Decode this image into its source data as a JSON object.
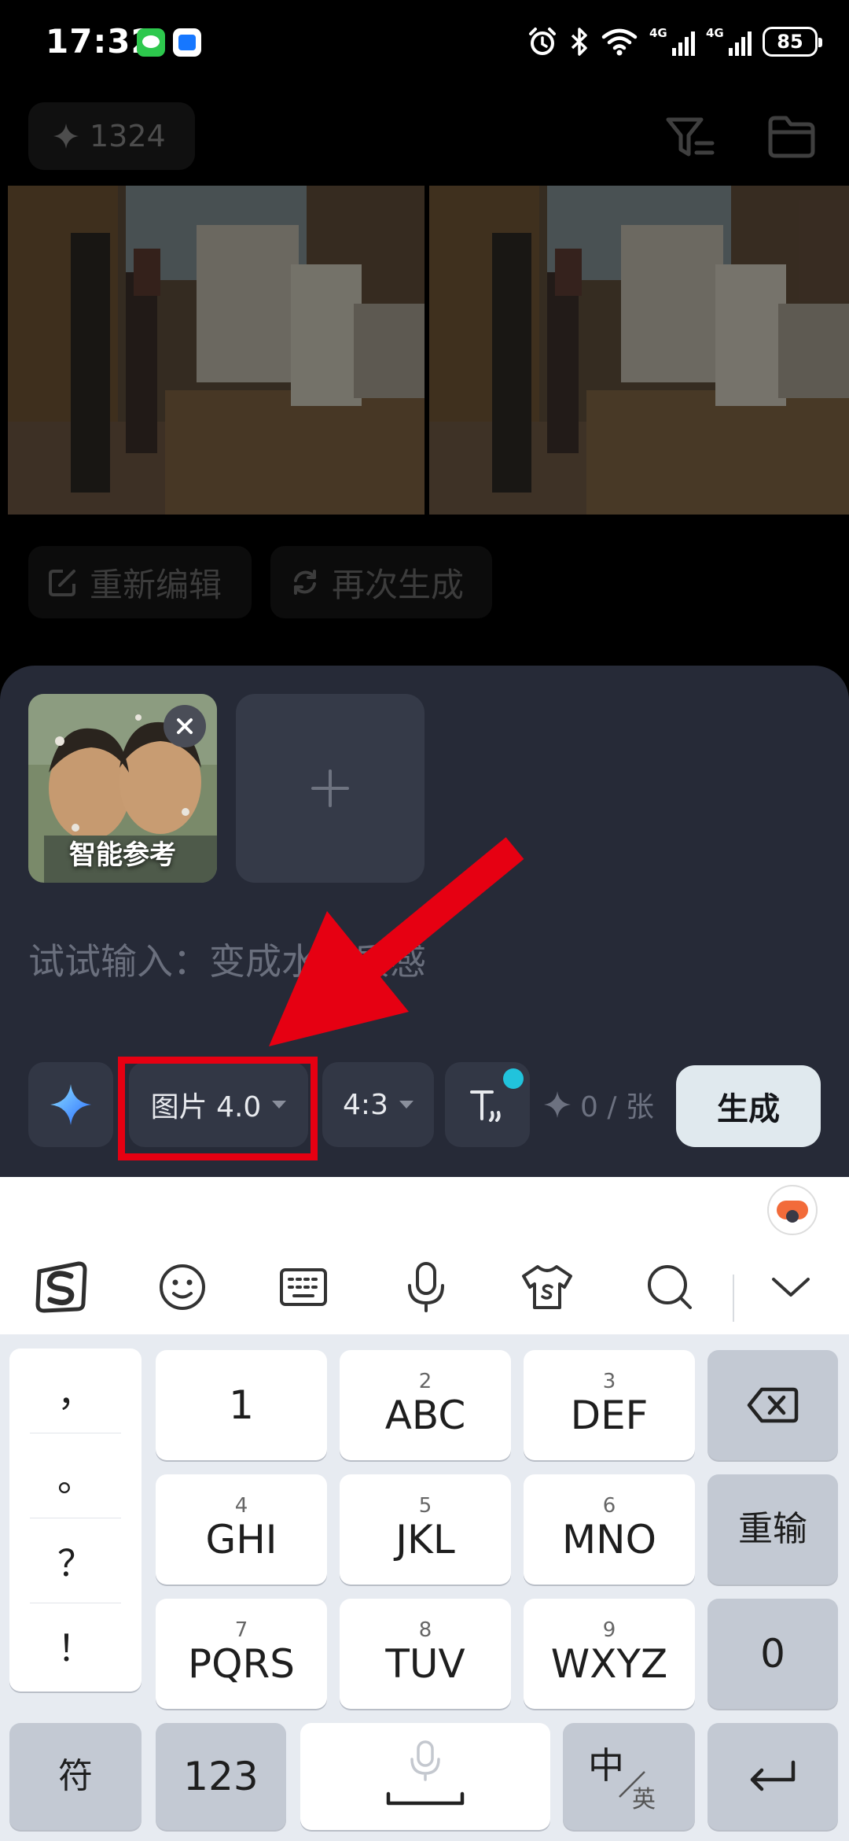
{
  "status_bar": {
    "time": "17:32",
    "network_left": "4G",
    "network_right": "4G",
    "battery": "85"
  },
  "header": {
    "credits": "1324"
  },
  "result_actions": {
    "reedit_label": "重新编辑",
    "regenerate_label": "再次生成"
  },
  "composer": {
    "reference_label": "智能参考",
    "prompt_placeholder": "试试输入：变成水墨质感",
    "model_label": "图片 4.0",
    "ratio_label": "4:3",
    "count_label": "0 / 张",
    "generate_label": "生成"
  },
  "annotation": {
    "color": "#e60012"
  },
  "keyboard": {
    "punctuation": [
      "，",
      "。",
      "？",
      "！"
    ],
    "keys": [
      {
        "num": "",
        "main": "1"
      },
      {
        "num": "2",
        "main": "ABC"
      },
      {
        "num": "3",
        "main": "DEF"
      },
      {
        "num": "4",
        "main": "GHI"
      },
      {
        "num": "5",
        "main": "JKL"
      },
      {
        "num": "6",
        "main": "MNO"
      },
      {
        "num": "7",
        "main": "PQRS"
      },
      {
        "num": "8",
        "main": "TUV"
      },
      {
        "num": "9",
        "main": "WXYZ"
      }
    ],
    "retype_label": "重输",
    "zero_label": "0",
    "symbols_label": "符",
    "numbers_label": "123",
    "lang_main": "中",
    "lang_sub": "英"
  },
  "colors": {
    "panel": "#262a37",
    "generate_button": "#e0e9ee",
    "accent_dot": "#21c3dc"
  }
}
